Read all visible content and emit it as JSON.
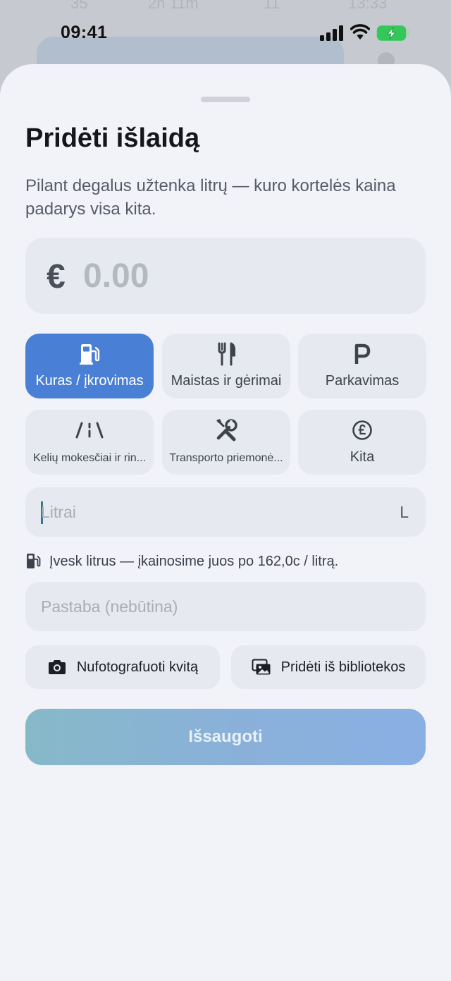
{
  "status_bar": {
    "time": "09:41"
  },
  "sheet": {
    "title": "Pridėti išlaidą",
    "subtitle": "Pilant degalus užtenka litrų — kuro kortelės kaina padarys visa kita.",
    "amount": {
      "currency": "€",
      "placeholder": "0.00"
    },
    "categories": [
      {
        "label": "Kuras / įkrovimas",
        "icon": "fuel-pump-icon",
        "selected": true
      },
      {
        "label": "Maistas ir gėrimai",
        "icon": "fork-knife-icon",
        "selected": false
      },
      {
        "label": "Parkavimas",
        "icon": "parking-icon",
        "selected": false
      },
      {
        "label": "Kelių mokesčiai ir rin...",
        "icon": "road-icon",
        "selected": false
      },
      {
        "label": "Transporto priemonė...",
        "icon": "wrench-screwdriver-icon",
        "selected": false
      },
      {
        "label": "Kita",
        "icon": "pound-circle-icon",
        "selected": false
      }
    ],
    "liters": {
      "placeholder": "Litrai",
      "unit": "L"
    },
    "hint": "Įvesk litrus — įkainosime juos po 162,0c / litrą.",
    "note": {
      "placeholder": "Pastaba (nebūtina)"
    },
    "buttons": {
      "camera": "Nufotografuoti kvitą",
      "library": "Pridėti iš bibliotekos",
      "save": "Išsaugoti"
    }
  },
  "colors": {
    "accent": "#4a7fd6",
    "sheet_bg": "#f1f3f9",
    "field_bg": "#e6e9f0",
    "battery": "#34c759"
  }
}
